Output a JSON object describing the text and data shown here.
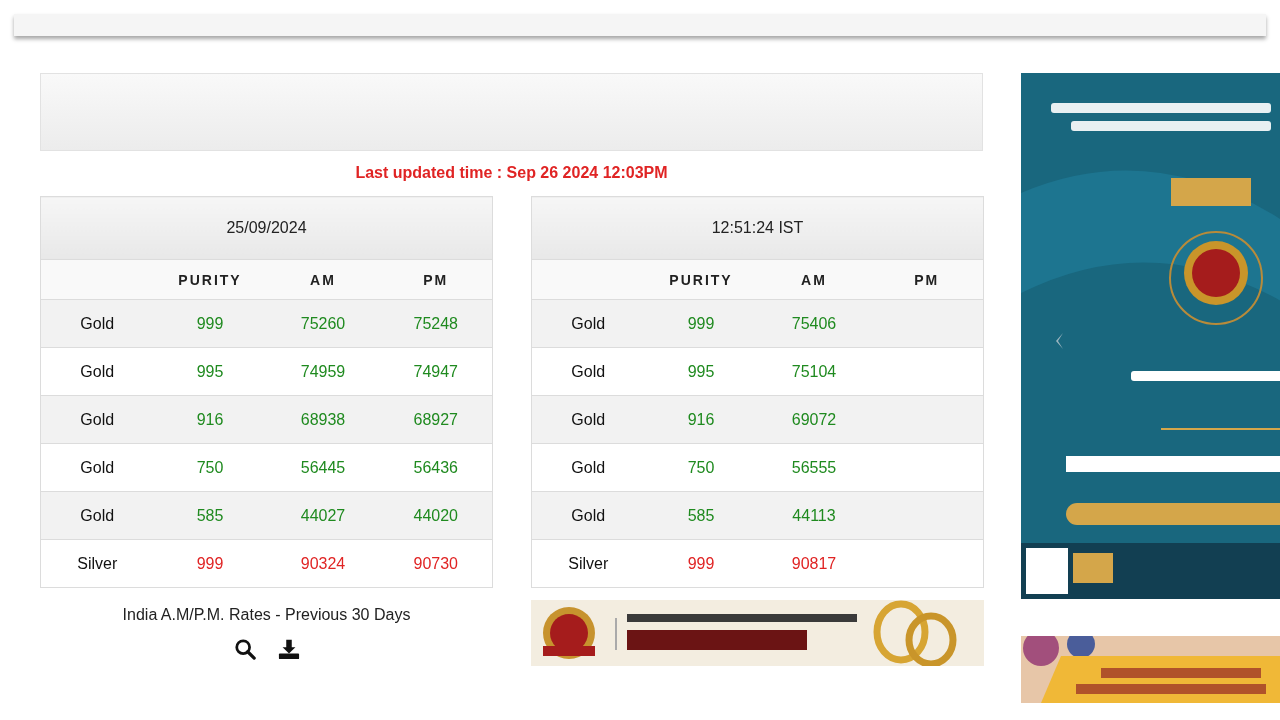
{
  "last_updated": "Last updated time : Sep 26 2024 12:03PM",
  "tables": [
    {
      "heading": "25/09/2024",
      "columns": [
        "PURITY",
        "AM",
        "PM"
      ],
      "rows": [
        {
          "metal": "Gold",
          "kind": "gold",
          "purity": "999",
          "am": "75260",
          "pm": "75248"
        },
        {
          "metal": "Gold",
          "kind": "gold",
          "purity": "995",
          "am": "74959",
          "pm": "74947"
        },
        {
          "metal": "Gold",
          "kind": "gold",
          "purity": "916",
          "am": "68938",
          "pm": "68927"
        },
        {
          "metal": "Gold",
          "kind": "gold",
          "purity": "750",
          "am": "56445",
          "pm": "56436"
        },
        {
          "metal": "Gold",
          "kind": "gold",
          "purity": "585",
          "am": "44027",
          "pm": "44020"
        },
        {
          "metal": "Silver",
          "kind": "silver",
          "purity": "999",
          "am": "90324",
          "pm": "90730"
        }
      ]
    },
    {
      "heading": "12:51:24 IST",
      "columns": [
        "PURITY",
        "AM",
        "PM"
      ],
      "rows": [
        {
          "metal": "Gold",
          "kind": "gold",
          "purity": "999",
          "am": "75406"
        },
        {
          "metal": "Gold",
          "kind": "gold",
          "purity": "995",
          "am": "75104"
        },
        {
          "metal": "Gold",
          "kind": "gold",
          "purity": "916",
          "am": "69072"
        },
        {
          "metal": "Gold",
          "kind": "gold",
          "purity": "750",
          "am": "56555"
        },
        {
          "metal": "Gold",
          "kind": "gold",
          "purity": "585",
          "am": "44113"
        },
        {
          "metal": "Silver",
          "kind": "silver",
          "purity": "999",
          "am": "90817"
        }
      ]
    }
  ],
  "history_link": "India A.M/P.M. Rates - Previous 30 Days"
}
